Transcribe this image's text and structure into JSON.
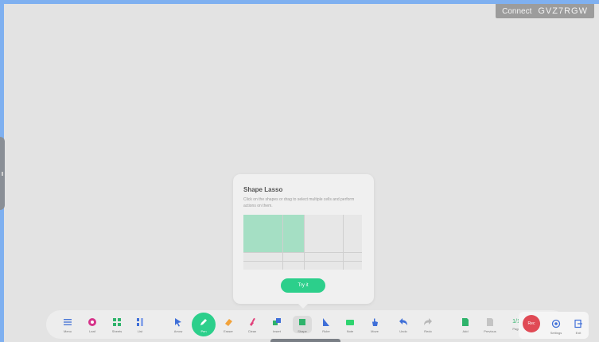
{
  "header": {
    "connect_label": "Connect",
    "connect_code": "GVZ7RGW"
  },
  "popup": {
    "title": "Shape Lasso",
    "description": "Click on the shapes or drag to select multiple cells and perform actions on them.",
    "try_label": "Try it"
  },
  "toolbar": {
    "items": [
      {
        "label": "Menu",
        "icon": "menu-icon"
      },
      {
        "label": "Leaf",
        "icon": "leaf-icon"
      },
      {
        "label": "Sheets",
        "icon": "grid-icon"
      },
      {
        "label": "List",
        "icon": "list-icon"
      },
      {
        "label": "Arrow",
        "icon": "cursor-icon"
      },
      {
        "label": "Pen",
        "icon": "pen-icon"
      },
      {
        "label": "Eraser",
        "icon": "eraser-icon"
      },
      {
        "label": "Clean",
        "icon": "brush-icon"
      },
      {
        "label": "Insert",
        "icon": "insert-icon"
      },
      {
        "label": "Shape",
        "icon": "square-icon"
      },
      {
        "label": "Ruler",
        "icon": "ruler-icon"
      },
      {
        "label": "Note",
        "icon": "note-icon"
      },
      {
        "label": "Move",
        "icon": "hand-icon"
      },
      {
        "label": "Undo",
        "icon": "undo-icon"
      },
      {
        "label": "Redo",
        "icon": "redo-icon"
      },
      {
        "label": "Add",
        "icon": "add-page-icon"
      },
      {
        "label": "Previous",
        "icon": "prev-page-icon"
      },
      {
        "label": "Page",
        "icon": "page-count-icon"
      }
    ],
    "page_counter": "1/1",
    "record_label": "Rec",
    "settings_label": "Settings",
    "exit_label": "Exit"
  },
  "colors": {
    "accent": "#2ccf8b",
    "record": "#e04a55",
    "frame": "#7fb0f0"
  }
}
